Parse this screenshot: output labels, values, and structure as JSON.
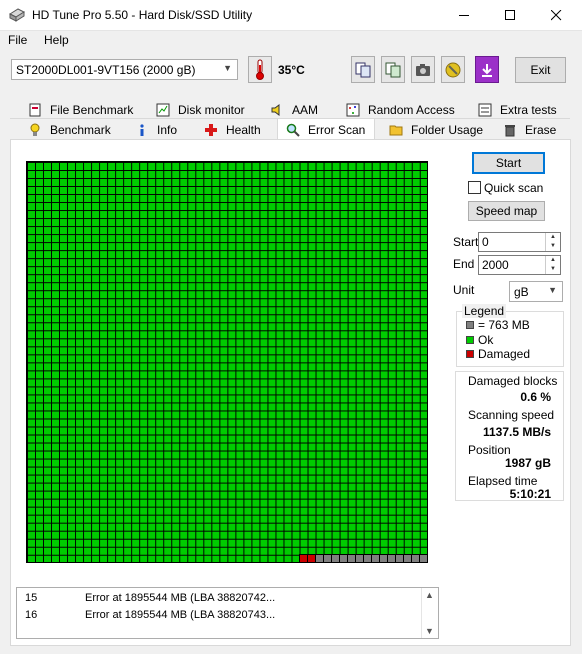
{
  "window": {
    "title": "HD Tune Pro 5.50 - Hard Disk/SSD Utility"
  },
  "menu": {
    "file": "File",
    "help": "Help"
  },
  "toolbar": {
    "drive": "ST2000DL001-9VT156 (2000 gB)",
    "temperature": "35°C",
    "exit_label": "Exit"
  },
  "tabs": {
    "row1": [
      "File Benchmark",
      "Disk monitor",
      "AAM",
      "Random Access",
      "Extra tests"
    ],
    "row2": [
      "Benchmark",
      "Info",
      "Health",
      "Error Scan",
      "Folder Usage",
      "Erase"
    ],
    "active": "Error Scan"
  },
  "controls": {
    "start_label": "Start",
    "quick_scan_label": "Quick scan",
    "quick_scan_checked": false,
    "speed_map_label": "Speed map",
    "start_field_label": "Start",
    "start_value": "0",
    "end_field_label": "End",
    "end_value": "2000",
    "unit_label": "Unit",
    "unit_value": "gB"
  },
  "legend": {
    "title": "Legend",
    "items": [
      {
        "label": "= 763 MB",
        "color": "#808080"
      },
      {
        "label": "Ok",
        "color": "#00cc00"
      },
      {
        "label": "Damaged",
        "color": "#cc0000"
      }
    ]
  },
  "stats": {
    "damaged_label": "Damaged blocks",
    "damaged_value": "0.6 %",
    "speed_label": "Scanning speed",
    "speed_value": "1137.5 MB/s",
    "position_label": "Position",
    "position_value": "1987 gB",
    "elapsed_label": "Elapsed time",
    "elapsed_value": "5:10:21"
  },
  "scan_map": {
    "columns": 50,
    "rows": 50,
    "ok_color": "#00cc00",
    "damaged_color": "#cc0000",
    "pending_color": "#808080",
    "damaged_blocks_last_row": 2,
    "pending_blocks_last_row": 14
  },
  "log": [
    {
      "num": "15",
      "text": "Error at 1895544 MB (LBA 38820742..."
    },
    {
      "num": "16",
      "text": "Error at 1895544 MB (LBA 38820743..."
    }
  ]
}
